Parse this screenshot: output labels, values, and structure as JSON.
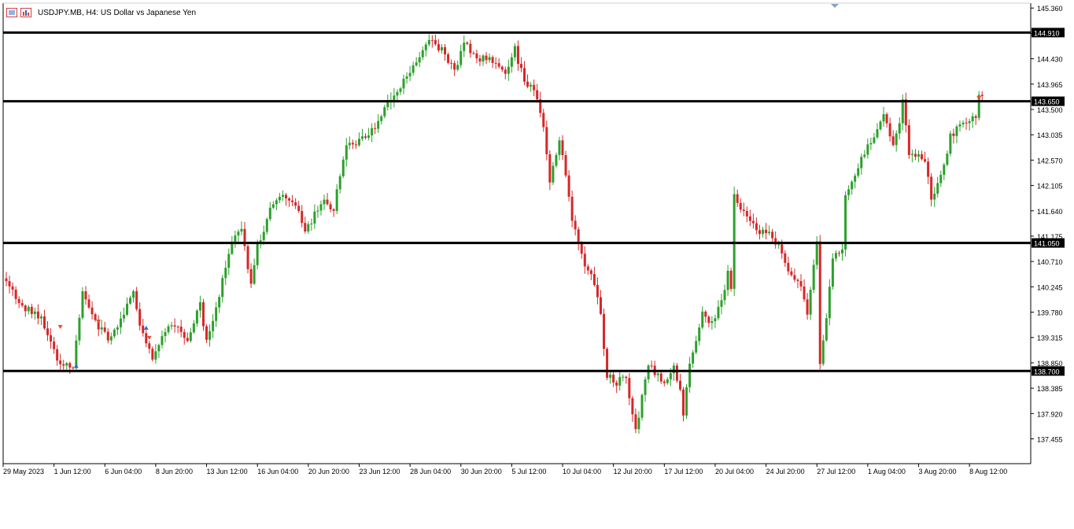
{
  "window": {
    "title": "USDJPY.MB, H4:  US Dollar vs Japanese Yen"
  },
  "colors": {
    "background": "#ffffff",
    "axis": "#000000",
    "bull_candle": "#2ca02c",
    "bear_candle": "#d62728",
    "level_line": "#000000",
    "buy_arrow": "#1f6fd0",
    "sell_arrow": "#e05030"
  },
  "icons": [
    "chart-list-icon",
    "chart-bars-icon"
  ],
  "chart_data": {
    "type": "candlestick",
    "symbol": "USDJPY.MB",
    "timeframe": "H4",
    "title": "USDJPY.MB, H4:  US Dollar vs Japanese Yen",
    "y_tick_labels": [
      "145.360",
      "144.910",
      "144.430",
      "143.965",
      "143.500",
      "143.035",
      "142.570",
      "142.105",
      "141.640",
      "141.175",
      "140.710",
      "140.245",
      "139.780",
      "139.315",
      "138.850",
      "138.385",
      "137.920",
      "137.455"
    ],
    "y_ticks": [
      145.36,
      144.895,
      144.43,
      143.965,
      143.5,
      143.035,
      142.57,
      142.105,
      141.64,
      141.175,
      140.71,
      140.245,
      139.78,
      139.315,
      138.85,
      138.385,
      137.92,
      137.455
    ],
    "ylim": [
      137.0,
      145.45
    ],
    "x_tick_labels": [
      "29 May 2023",
      "1 Jun 12:00",
      "6 Jun 04:00",
      "8 Jun 20:00",
      "13 Jun 12:00",
      "16 Jun 04:00",
      "20 Jun 20:00",
      "23 Jun 12:00",
      "28 Jun 04:00",
      "30 Jun 20:00",
      "5 Jul 12:00",
      "10 Jul 04:00",
      "12 Jul 20:00",
      "17 Jul 12:00",
      "20 Jul 04:00",
      "24 Jul 20:00",
      "27 Jul 12:00",
      "1 Aug 04:00",
      "3 Aug 20:00",
      "8 Aug 12:00"
    ],
    "x_tick_bar_index": [
      0,
      16,
      32,
      48,
      64,
      80,
      96,
      112,
      128,
      144,
      160,
      176,
      192,
      208,
      224,
      240,
      256,
      272,
      288,
      304
    ],
    "horizontal_levels": [
      {
        "value": 144.91,
        "label": "144.910"
      },
      {
        "value": 143.65,
        "label": "143.650"
      },
      {
        "value": 141.05,
        "label": "141.050"
      },
      {
        "value": 138.7,
        "label": "138.700"
      }
    ],
    "anchors": [
      [
        0,
        140.4
      ],
      [
        6,
        139.9
      ],
      [
        12,
        139.7
      ],
      [
        18,
        138.8
      ],
      [
        22,
        138.8
      ],
      [
        25,
        140.1
      ],
      [
        29,
        139.6
      ],
      [
        33,
        139.3
      ],
      [
        36,
        139.55
      ],
      [
        41,
        140.1
      ],
      [
        43,
        139.6
      ],
      [
        47,
        138.95
      ],
      [
        50,
        139.35
      ],
      [
        54,
        139.55
      ],
      [
        58,
        139.3
      ],
      [
        62,
        139.9
      ],
      [
        64,
        139.25
      ],
      [
        68,
        140.1
      ],
      [
        72,
        141.1
      ],
      [
        75,
        141.3
      ],
      [
        78,
        140.3
      ],
      [
        80,
        141.0
      ],
      [
        85,
        141.8
      ],
      [
        88,
        141.9
      ],
      [
        92,
        141.8
      ],
      [
        95,
        141.25
      ],
      [
        100,
        141.8
      ],
      [
        104,
        141.7
      ],
      [
        108,
        142.9
      ],
      [
        112,
        142.9
      ],
      [
        116,
        143.1
      ],
      [
        120,
        143.5
      ],
      [
        124,
        143.8
      ],
      [
        128,
        144.2
      ],
      [
        134,
        144.8
      ],
      [
        138,
        144.6
      ],
      [
        142,
        144.2
      ],
      [
        145,
        144.7
      ],
      [
        150,
        144.4
      ],
      [
        153,
        144.5
      ],
      [
        158,
        144.1
      ],
      [
        161,
        144.6
      ],
      [
        164,
        144.0
      ],
      [
        167,
        143.9
      ],
      [
        170,
        143.2
      ],
      [
        172,
        142.2
      ],
      [
        175,
        142.9
      ],
      [
        177,
        142.3
      ],
      [
        179,
        141.5
      ],
      [
        182,
        140.8
      ],
      [
        186,
        140.3
      ],
      [
        188,
        139.7
      ],
      [
        190,
        138.6
      ],
      [
        193,
        138.5
      ],
      [
        196,
        138.6
      ],
      [
        198,
        137.9
      ],
      [
        199,
        137.6
      ],
      [
        201,
        138.2
      ],
      [
        203,
        138.8
      ],
      [
        206,
        138.6
      ],
      [
        208,
        138.5
      ],
      [
        211,
        138.75
      ],
      [
        213,
        138.3
      ],
      [
        214,
        137.9
      ],
      [
        216,
        138.8
      ],
      [
        220,
        139.8
      ],
      [
        223,
        139.55
      ],
      [
        226,
        140.0
      ],
      [
        228,
        140.5
      ],
      [
        229,
        140.15
      ],
      [
        230,
        141.9
      ],
      [
        233,
        141.6
      ],
      [
        237,
        141.3
      ],
      [
        241,
        141.2
      ],
      [
        245,
        140.9
      ],
      [
        248,
        140.4
      ],
      [
        251,
        140.3
      ],
      [
        253,
        139.7
      ],
      [
        256,
        141.1
      ],
      [
        257,
        138.85
      ],
      [
        259,
        139.7
      ],
      [
        261,
        140.8
      ],
      [
        264,
        140.9
      ],
      [
        265,
        141.9
      ],
      [
        268,
        142.3
      ],
      [
        270,
        142.6
      ],
      [
        274,
        143.0
      ],
      [
        277,
        143.4
      ],
      [
        280,
        142.9
      ],
      [
        282,
        143.2
      ],
      [
        283,
        143.65
      ],
      [
        285,
        142.7
      ],
      [
        287,
        142.7
      ],
      [
        290,
        142.6
      ],
      [
        292,
        141.8
      ],
      [
        294,
        142.1
      ],
      [
        296,
        142.5
      ],
      [
        298,
        143.0
      ],
      [
        301,
        143.2
      ],
      [
        305,
        143.4
      ],
      [
        306,
        143.35
      ],
      [
        307,
        143.7
      ]
    ],
    "marker_arrows": [
      {
        "bar": 17,
        "price": 139.5,
        "direction": "down"
      },
      {
        "bar": 22,
        "price": 138.8,
        "direction": "up"
      },
      {
        "bar": 29,
        "price": 139.6,
        "direction": "down"
      },
      {
        "bar": 44,
        "price": 139.5,
        "direction": "up"
      },
      {
        "bar": 45,
        "price": 139.3,
        "direction": "down"
      },
      {
        "bar": 306,
        "price": 143.7,
        "direction": "down"
      }
    ],
    "bar_count": 308
  }
}
